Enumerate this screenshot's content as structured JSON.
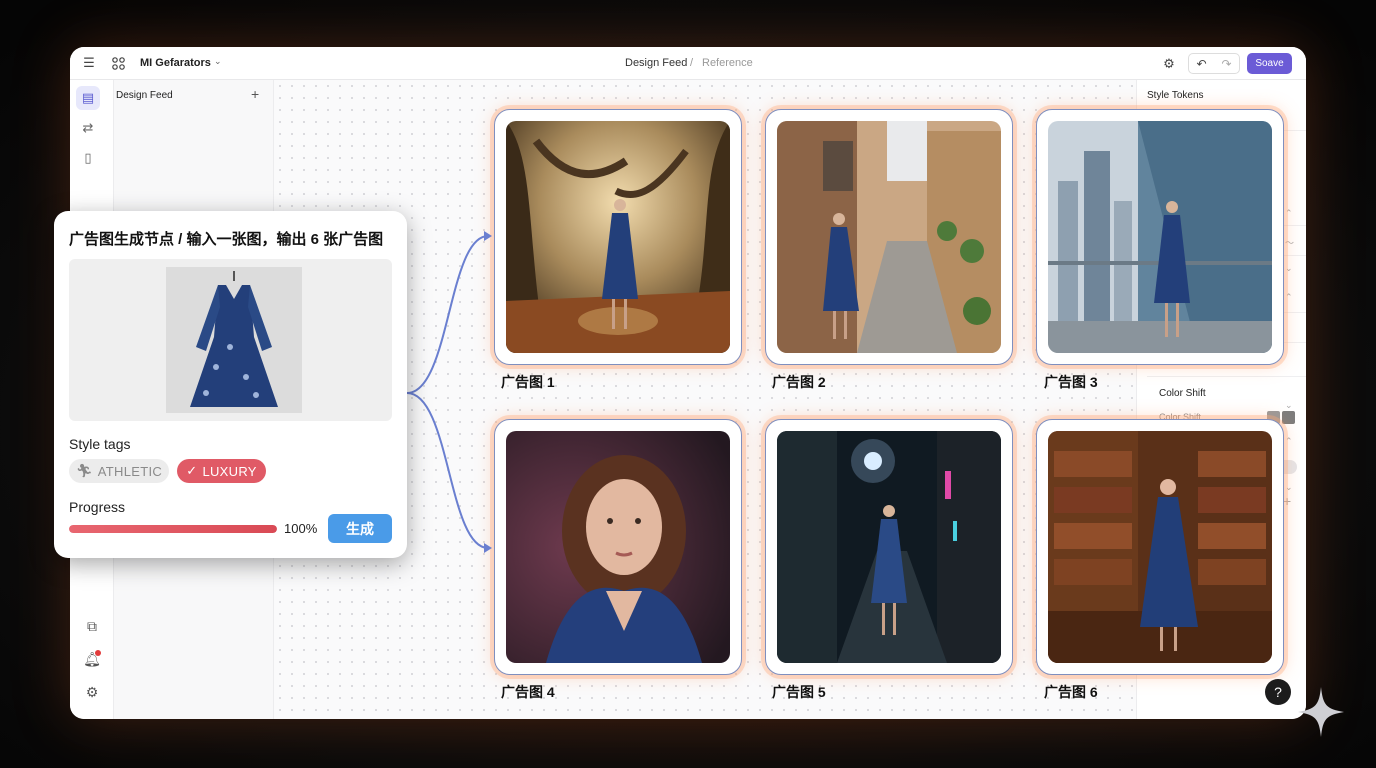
{
  "header": {
    "app_name": "MI Gefarators",
    "breadcrumb": "Design Feed",
    "breadcrumb_sep": "/",
    "breadcrumb_current": "Reference",
    "save_label": "Soave"
  },
  "sidepanel": {
    "title": "Design Feed"
  },
  "rightpanel": {
    "title": "Style Tokens",
    "section": "Color Shift",
    "sub": "Color Shift",
    "swatches": [
      "#9a9a9a",
      "#7d7d7d"
    ]
  },
  "node": {
    "title": "广告图生成节点 / 输入一张图，输出 6 张广告图",
    "tags_label": "Style tags",
    "tags": [
      "ATHLETIC",
      "LUXURY"
    ],
    "progress_label": "Progress",
    "progress_value": 100,
    "progress_text": "100%",
    "generate_label": "生成"
  },
  "cards": [
    {
      "label": "广告图 1",
      "scene": "forest"
    },
    {
      "label": "广告图 2",
      "scene": "alley"
    },
    {
      "label": "广告图 3",
      "scene": "skyscraper balcony"
    },
    {
      "label": "广告图 4",
      "scene": "portrait"
    },
    {
      "label": "广告图 5",
      "scene": "neon street night"
    },
    {
      "label": "广告图 6",
      "scene": "library"
    }
  ],
  "colors": {
    "accent": "#6b5bd6",
    "progress": "#d94a55",
    "generate": "#4a9be8",
    "connector": "#6a7fd0"
  },
  "help_label": "?"
}
